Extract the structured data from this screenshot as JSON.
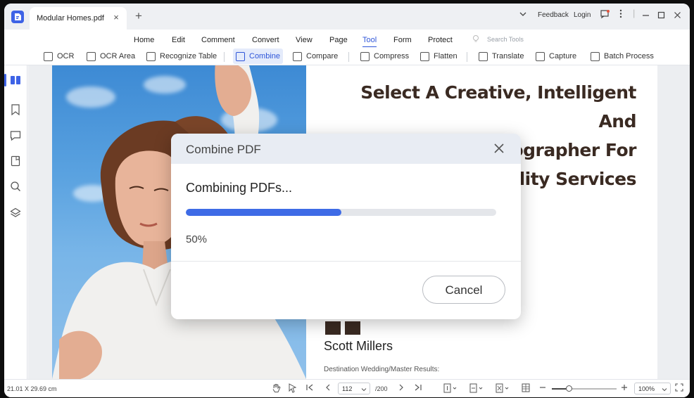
{
  "titlebar": {
    "tab_title": "Modular Homes.pdf",
    "close_glyph": "×",
    "new_tab_glyph": "+",
    "feedback": "Feedback",
    "login": "Login"
  },
  "menu": {
    "items": [
      "Home",
      "Edit",
      "Comment",
      "Convert",
      "View",
      "Page",
      "Tool",
      "Form",
      "Protect"
    ],
    "active": "Tool",
    "search_placeholder": "Search Tools"
  },
  "toolbar": {
    "tools": [
      "OCR",
      "OCR Area",
      "Recognize Table",
      "Combine",
      "Compare",
      "Compress",
      "Flatten",
      "Translate",
      "Capture",
      "Batch Process"
    ],
    "active": "Combine"
  },
  "sidebar": {
    "icons": [
      "thumbnails-icon",
      "bookmark-icon",
      "comment-icon",
      "attachment-icon",
      "search-icon",
      "layers-icon"
    ]
  },
  "document": {
    "headline_lines": [
      "Select A Creative, Intelligent And",
      "Experienced Photographer For",
      "uality Services"
    ],
    "author": "Scott Millers",
    "author_subtitle": "Destination Wedding/Master Results:"
  },
  "modal": {
    "title": "Combine PDF",
    "status": "Combining PDFs...",
    "progress": 0.5,
    "percent_label": "50%",
    "cancel_label": "Cancel"
  },
  "statusbar": {
    "dimensions": "21.01 X 29.69 cm",
    "current_page": "112",
    "total_pages": "/200",
    "zoom": "100%"
  },
  "colors": {
    "accent": "#3e6be6",
    "headline": "#3a2a22"
  }
}
